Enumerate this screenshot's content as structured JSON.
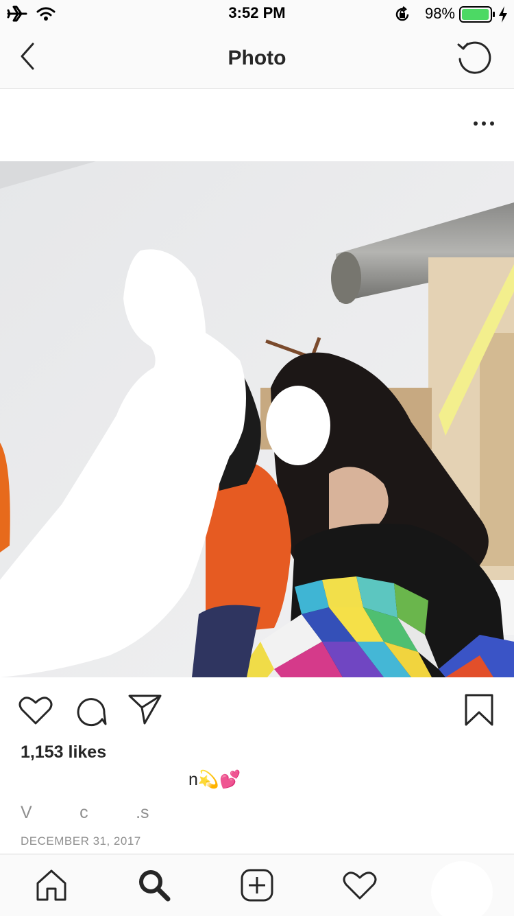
{
  "status_bar": {
    "time": "3:52 PM",
    "battery_percent": "98%",
    "battery_level": 0.98,
    "icons": [
      "airplane-icon",
      "wifi-icon",
      "orientation-lock-icon",
      "battery-icon",
      "charging-bolt-icon"
    ]
  },
  "nav": {
    "title": "Photo",
    "back_icon": "chevron-left-icon",
    "refresh_icon": "refresh-icon"
  },
  "post": {
    "more_icon": "more-horizontal-icon",
    "likes": "1,153 likes",
    "caption": "n💫💕",
    "comment_preview": "V          c          .s",
    "date": "DECEMBER 31, 2017",
    "actions": [
      "like-icon",
      "comment-icon",
      "share-icon",
      "bookmark-icon"
    ]
  },
  "tab_bar": {
    "items": [
      "home",
      "search",
      "new-post",
      "activity",
      "profile"
    ]
  },
  "colors": {
    "text": "#262626",
    "secondary_text": "#8e8e8e",
    "battery_green": "#4cd964",
    "bar_background": "#fafafa"
  }
}
